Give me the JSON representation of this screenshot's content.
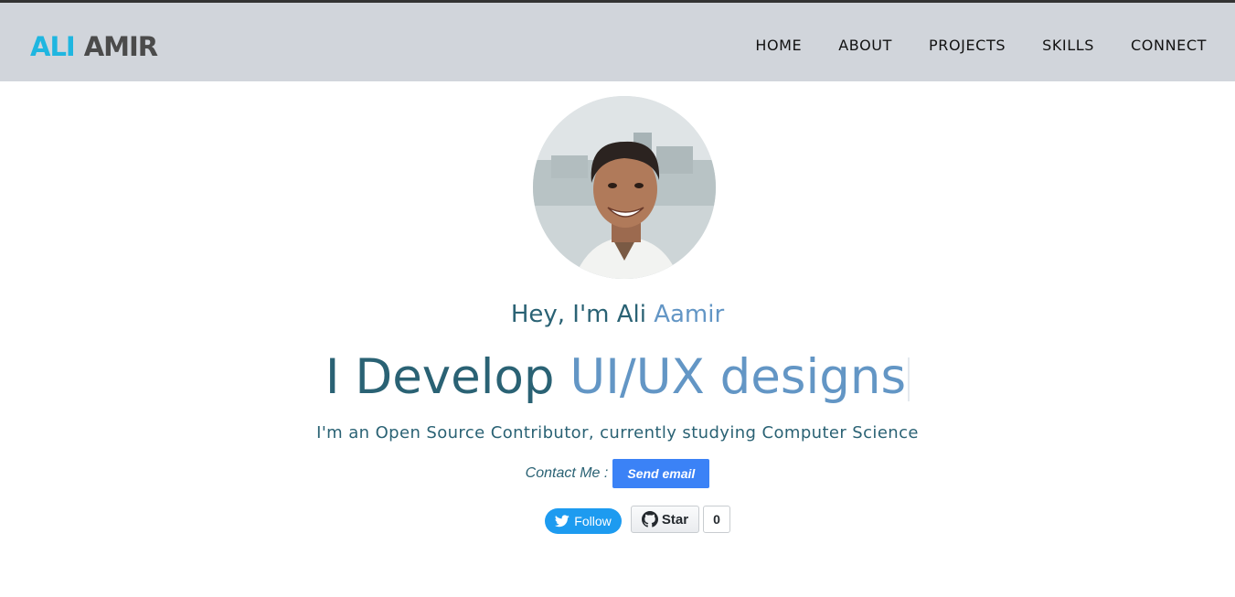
{
  "brand": {
    "first": "ALI",
    "last": "AMIR"
  },
  "nav": {
    "items": [
      "HOME",
      "ABOUT",
      "PROJECTS",
      "SKILLS",
      "CONNECT"
    ]
  },
  "hero": {
    "greeting_prefix": "Hey, I'm Ali ",
    "greeting_highlight": "Aamir",
    "headline_prefix": "I Develop ",
    "headline_highlight": "UI/UX designs",
    "subline": "I'm an Open Source Contributor, currently studying Computer Science",
    "contact_label": "Contact Me :",
    "contact_button": "Send email"
  },
  "social": {
    "twitter_label": "Follow",
    "github_label": "Star",
    "github_count": "0"
  },
  "colors": {
    "navbar_bg": "#d1d5db",
    "logo_accent": "#1fb6e0",
    "text_primary": "#2a6274",
    "text_highlight": "#6396c5",
    "button_blue": "#3b82f6",
    "twitter_blue": "#1d9bf0"
  },
  "icons": [
    "twitter-bird-icon",
    "github-octocat-icon"
  ]
}
